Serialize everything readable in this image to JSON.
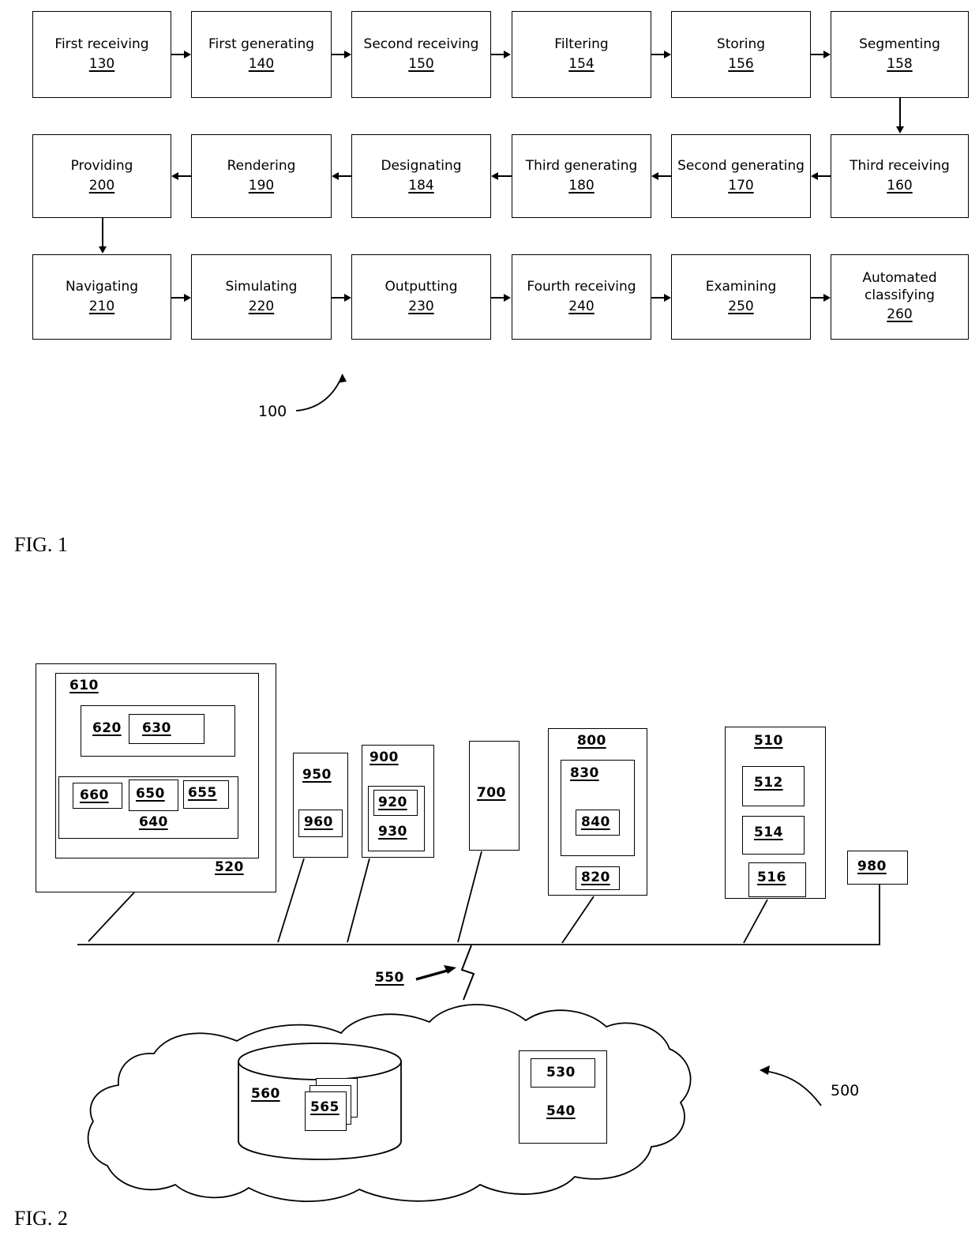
{
  "figure1": {
    "caption": "FIG. 1",
    "ref_label": "100",
    "row1": [
      {
        "label": "First receiving",
        "num": "130"
      },
      {
        "label": "First generating",
        "num": "140"
      },
      {
        "label": "Second receiving",
        "num": "150"
      },
      {
        "label": "Filtering",
        "num": "154"
      },
      {
        "label": "Storing",
        "num": "156"
      },
      {
        "label": "Segmenting",
        "num": "158"
      }
    ],
    "row2": [
      {
        "label": "Providing",
        "num": "200"
      },
      {
        "label": "Rendering",
        "num": "190"
      },
      {
        "label": "Designating",
        "num": "184"
      },
      {
        "label": "Third generating",
        "num": "180"
      },
      {
        "label": "Second generating",
        "num": "170"
      },
      {
        "label": "Third receiving",
        "num": "160"
      }
    ],
    "row3": [
      {
        "label": "Navigating",
        "num": "210"
      },
      {
        "label": "Simulating",
        "num": "220"
      },
      {
        "label": "Outputting",
        "num": "230"
      },
      {
        "label": "Fourth receiving",
        "num": "240"
      },
      {
        "label": "Examining",
        "num": "250"
      },
      {
        "label": "Automated classifying",
        "num": "260"
      }
    ]
  },
  "figure2": {
    "caption": "FIG. 2",
    "system_ref": "500",
    "bus_ref": "550",
    "labels": {
      "outer_520": "520",
      "inner_610": "610",
      "b620": "620",
      "b630": "630",
      "b640": "640",
      "b650": "650",
      "b655": "655",
      "b660": "660",
      "b950": "950",
      "b960": "960",
      "b900": "900",
      "b920": "920",
      "b930": "930",
      "b700": "700",
      "b800": "800",
      "b830": "830",
      "b840": "840",
      "b820": "820",
      "b510": "510",
      "b512": "512",
      "b514": "514",
      "b516": "516",
      "b980": "980",
      "db560": "560",
      "db565": "565",
      "b530": "530",
      "b540": "540"
    }
  }
}
